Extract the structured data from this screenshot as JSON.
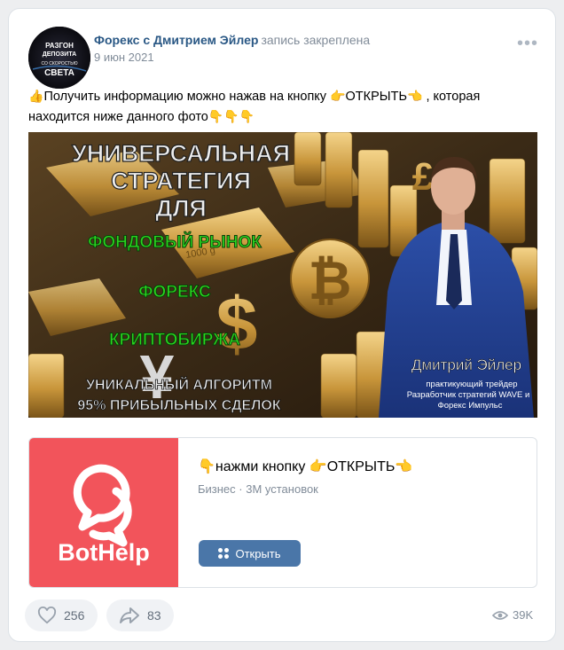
{
  "post": {
    "author": "Форекс с Дмитрием Эйлер",
    "pinned_label": "запись закреплена",
    "date": "9 июн 2021",
    "avatar_text": [
      "РАЗГОН",
      "ДЕПОЗИТА",
      "СО СКОРОСТЬЮ",
      "СВЕТА"
    ],
    "text_part1": "Получить информацию можно нажав на кнопку ",
    "text_open": "ОТКРЫТЬ",
    "text_part2": " , которая находится ниже данного фото",
    "icons": {
      "thumbs_up": "👍",
      "point_right": "👉",
      "point_left": "👈",
      "point_down": "👇",
      "more": "more-horizontal-icon"
    }
  },
  "banner": {
    "title_lines": [
      "УНИВЕРСАЛЬНАЯ",
      "СТРАТЕГИЯ",
      "ДЛЯ"
    ],
    "markets": [
      "ФОНДОВЫЙ РЫНОК",
      "ФОРЕКС",
      "КРИПТОБИРЖА"
    ],
    "algo_lines": [
      "УНИКАЛЬНЫЙ АЛГОРИТМ",
      "95% ПРИБЫЛЬНЫХ СДЕЛОК"
    ],
    "person_name": "Дмитрий Эйлер",
    "person_desc": [
      "практикующий трейдер",
      "Разработчик стратегий WAVE  и",
      "Форекс Импульс"
    ],
    "bar_label": "1000 g",
    "colors": {
      "title": "#e8e8e8",
      "market_green": "#29d61f",
      "gold": "#c8953a"
    }
  },
  "app_card": {
    "title_text": "нажми кнопку ",
    "title_open": "ОТКРЫТЬ",
    "subtitle": "Бизнес · 3М установок",
    "logo_text": "BotHelp",
    "button_label": "Открыть",
    "colors": {
      "logo_bg": "#f2545b",
      "button": "#4a76a8"
    }
  },
  "footer": {
    "likes": "256",
    "shares": "83",
    "views": "39K"
  }
}
